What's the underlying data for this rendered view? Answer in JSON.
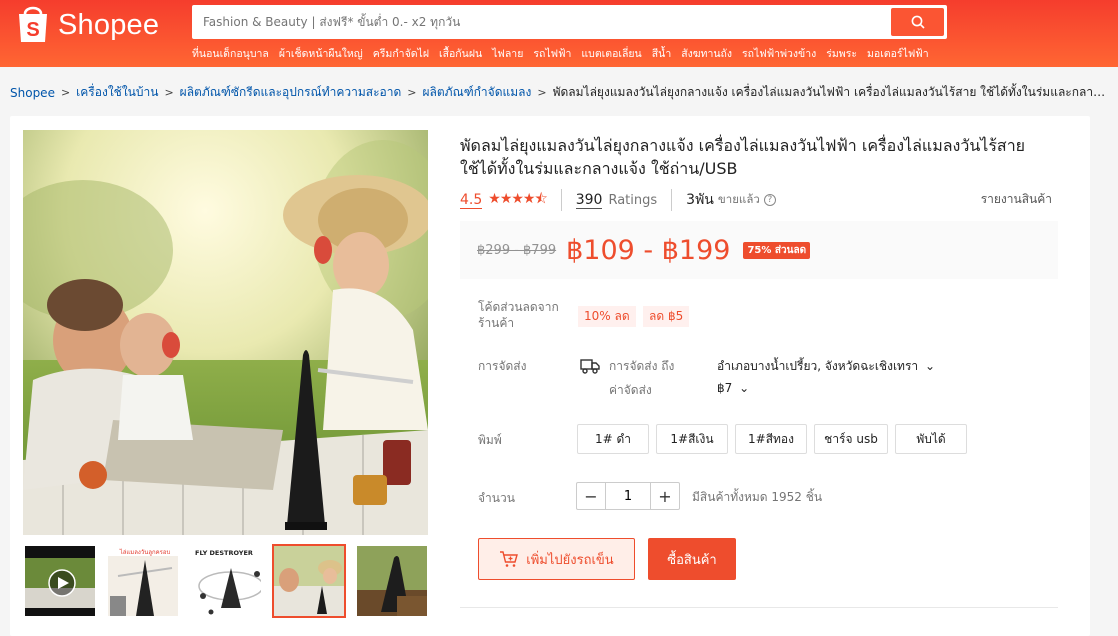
{
  "header": {
    "logo_text": "Shopee",
    "search_placeholder": "Fashion & Beauty | ส่งฟรี* ขั้นต่ำ 0.- x2 ทุกวัน",
    "hot_links": [
      "ที่นอนเด็กอนุบาล",
      "ผ้าเช็ดหน้าผืนใหญ่",
      "ครีมกำจัดไฝ",
      "เสื้อกันฝน",
      "ไฟลาย",
      "รถไฟฟ้า",
      "แบตเตอเลี่ยน",
      "สีน้ำ",
      "สังฆทานถัง",
      "รถไฟฟ้าพ่วงข้าง",
      "ร่มพระ",
      "มอเตอร์ไฟฟ้า"
    ]
  },
  "breadcrumb": {
    "items": [
      "Shopee",
      "เครื่องใช้ในบ้าน",
      "ผลิตภัณฑ์ซักรีดและอุปกรณ์ทำความสะอาด",
      "ผลิตภัณฑ์กำจัดแมลง"
    ],
    "current": "พัดลมไล่ยุงแมลงวันไล่ยุงกลางแจ้ง เครื่องไล่แมลงวันไฟฟ้า เครื่องไล่แมลงวันไร้สาย ใช้ได้ทั้งในร่มและกลางแจ้ง ใ..."
  },
  "product": {
    "title": "พัดลมไล่ยุงแมลงวันไล่ยุงกลางแจ้ง เครื่องไล่แมลงวันไฟฟ้า เครื่องไล่แมลงวันไร้สาย ใช้ได้ทั้งในร่มและกลางแจ้ง ใช้ถ่าน/USB",
    "rating": "4.5",
    "stars": "★★★★⯪",
    "ratings_count": "390",
    "ratings_label": "Ratings",
    "sold": "3พัน",
    "sold_label": "ขายแล้ว",
    "report": "รายงานสินค้า",
    "old_price": "฿299 - ฿799",
    "price": "฿109 - ฿199",
    "discount": "75% ส่วนลด",
    "vouchers_label": "โค้ดส่วนลดจากร้านค้า",
    "vouchers": [
      "10% ลด",
      "ลด ฿5"
    ],
    "shipping_label": "การจัดส่ง",
    "ship_to_label": "การจัดส่ง ถึง",
    "ship_location": "อำเภอบางน้ำเปรี้ยว, จังหวัดฉะเชิงเทรา",
    "ship_fee_label": "ค่าจัดส่ง",
    "ship_fee": "฿7",
    "variant_label": "พิมพ์",
    "variants": [
      "1# ดำ",
      "1#สีเงิน",
      "1#สีทอง",
      "ชาร์จ usb",
      "พับได้"
    ],
    "qty_label": "จำนวน",
    "qty": "1",
    "stock": "มีสินค้าทั้งหมด 1952 ชิ้น",
    "add_to_cart": "เพิ่มไปยังรถเข็น",
    "buy_now": "ซื้อสินค้า"
  },
  "thumbnails": {
    "t2_caption": "ไล่แมลงวันลูกครอบ",
    "t3_caption": "FLY DESTROYER"
  },
  "colors": {
    "brand": "#ee4d2d",
    "header": "#f53d2d"
  }
}
